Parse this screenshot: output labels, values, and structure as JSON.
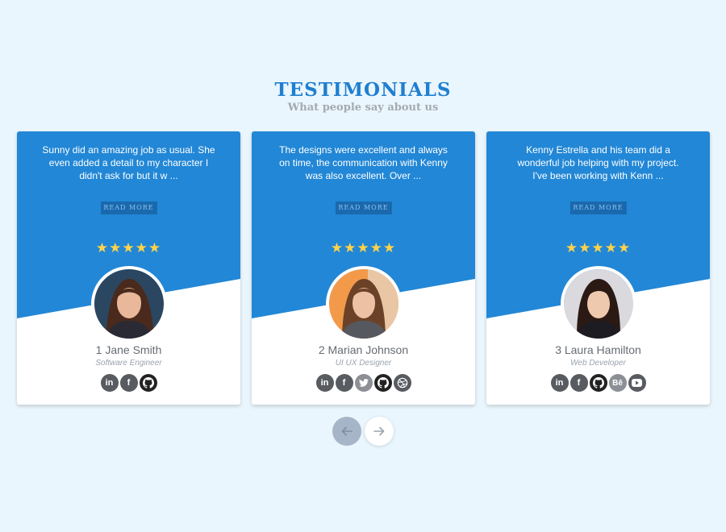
{
  "heading": {
    "title": "TESTIMONIALS",
    "subtitle": "What people say about us"
  },
  "colors": {
    "background": "#eaf6fd",
    "card_blue": "#2287d6",
    "accent": "#1f7fd1",
    "star": "#ffd34a"
  },
  "read_more_label": "READ MORE",
  "cards": [
    {
      "quote": "Sunny did an amazing job as usual. She even added a detail to my character I didn't ask for but it w ...",
      "stars": "★★★★★",
      "rating": 5,
      "name": "1 Jane Smith",
      "role": "Software Engineer",
      "socials": [
        {
          "icon": "linkedin-icon",
          "glyph": "in"
        },
        {
          "icon": "facebook-icon",
          "glyph": "f"
        },
        {
          "icon": "github-icon",
          "glyph": ""
        }
      ]
    },
    {
      "quote": "The designs were excellent and always on time, the communication with Kenny was also excellent. Over ...",
      "stars": "★★★★★",
      "rating": 5,
      "name": "2 Marian Johnson",
      "role": "UI UX Designer",
      "socials": [
        {
          "icon": "linkedin-icon",
          "glyph": "in"
        },
        {
          "icon": "facebook-icon",
          "glyph": "f"
        },
        {
          "icon": "twitter-icon",
          "glyph": ""
        },
        {
          "icon": "github-icon",
          "glyph": ""
        },
        {
          "icon": "dribbble-icon",
          "glyph": ""
        }
      ]
    },
    {
      "quote": "Kenny Estrella and his team did a wonderful job helping with my project. I've been working with Kenn ...",
      "stars": "★★★★★",
      "rating": 5,
      "name": "3 Laura Hamilton",
      "role": "Web Developer",
      "socials": [
        {
          "icon": "linkedin-icon",
          "glyph": "in"
        },
        {
          "icon": "facebook-icon",
          "glyph": "f"
        },
        {
          "icon": "github-icon",
          "glyph": ""
        },
        {
          "icon": "behance-icon",
          "glyph": "Bē"
        },
        {
          "icon": "youtube-icon",
          "glyph": ""
        }
      ]
    }
  ],
  "nav": {
    "prev_icon": "arrow-left-icon",
    "next_icon": "arrow-right-icon"
  }
}
